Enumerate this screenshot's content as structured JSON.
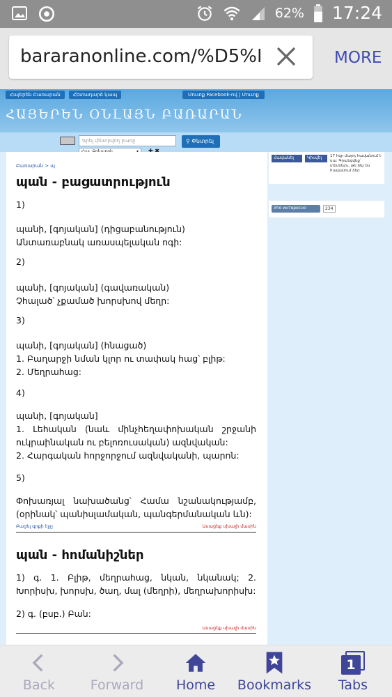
{
  "status_bar": {
    "battery_percent": "62%",
    "time": "17:24"
  },
  "browser": {
    "url": "bararanonline.com/%D5%B",
    "more_label": "MORE",
    "load_progress": 0.75
  },
  "site": {
    "nav_left": [
      "Հայերեն Բառարան",
      "Հետադարձ կապ"
    ],
    "nav_right": "Մուտք Facebook-ով | Մուտք",
    "logo": "ՀԱՅԵՐԵՆ ՕՆԼԱՅՆ ԲԱՌԱՐԱՆ",
    "search_placeholder": "Գրել փնտրվող բառը",
    "search_button": "Փնտրել",
    "language": "Հայ. Բոնստրև",
    "lang_tools": "✚ ✖"
  },
  "breadcrumb": "Բառարան > պ",
  "entries": [
    {
      "title": "պան - բացատրություն",
      "blocks": [
        "1)",
        "պանի, [գոյական] (դիցաբանություն)\nԱնտառաբնակ առասպելական ոգի:",
        "2)",
        "պանի, [գոյական] (գավառական)\nՉհալած՝ չքամած խորսխով մեղր:",
        "3)",
        "պանի, [գոյական] (հնացած)\n1. Բաղարջի նման կլոր ու տափակ հաց՝ բլիթ:\n2. Մեղրահաց:",
        "4)",
        "պանի, [գոյական]\n1. Լեհական (նաև մինչհեղափոխական շրջանի ուկրաինական ու բելոռուսական) ազնվական:\n2. Հարգական հորջորջում ազնվականի, պարոն:",
        "5)",
        "Փոխառյալ նախածանց՝ Համա նշանակությամբ, (օրինակ՝ պանիսլամական, պանգերմանական ևն):"
      ],
      "link_left": "Բացել գրքի էջը",
      "link_right": "Ասացեք սխալի մասին"
    },
    {
      "title": "պան - հոմանիշներ",
      "blocks": [
        "1) գ. 1. Բլիթ, մեղրահաց, նկան, նկանակ; 2. Խորիսխ, խորսխ, ծաղ, մալ (մեղրի), մեղրախորիսխ:",
        "2) գ. (բսբ.) Բան:"
      ],
      "link_right": "Ասացեք սխալի մասին"
    }
  ],
  "sidebar": {
    "fb_button": "Հավանել",
    "share_button": "Կիսվել",
    "fb_note": "17 հզր մարդ հավանում է սա: Գրանցվեք՝ տեսնելու, թե ինչ են հավանում ձեր",
    "vk_button": "Это интересно",
    "vk_count": "234"
  },
  "bottom_bar": {
    "back": "Back",
    "forward": "Forward",
    "home": "Home",
    "bookmarks": "Bookmarks",
    "tabs": "Tabs",
    "tabs_count": "1"
  }
}
